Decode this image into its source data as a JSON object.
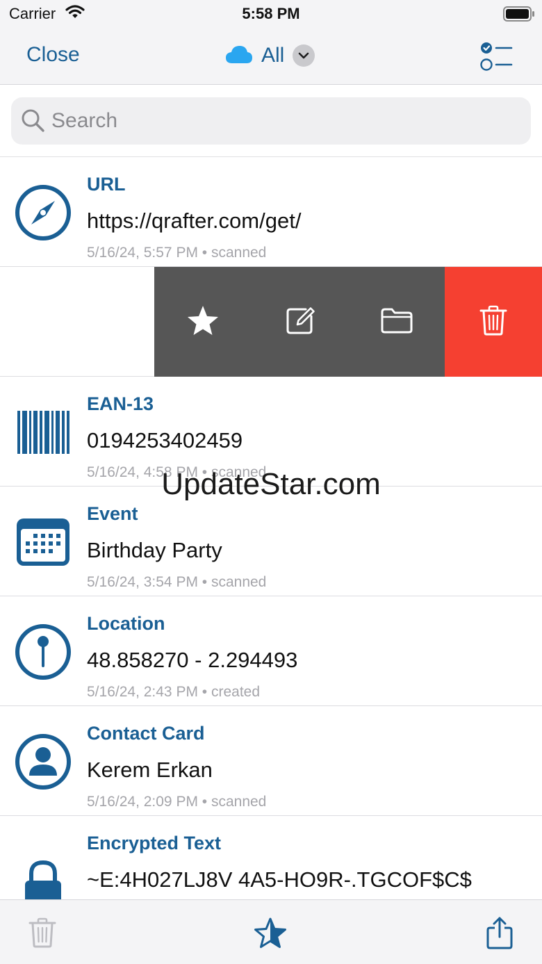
{
  "status_bar": {
    "carrier": "Carrier",
    "time": "5:58 PM"
  },
  "nav": {
    "close_label": "Close",
    "title": "All"
  },
  "search": {
    "placeholder": "Search"
  },
  "items": [
    {
      "type": "URL",
      "value": "https://qrafter.com/get/",
      "meta": "5/16/24, 5:57 PM • scanned",
      "icon": "compass-icon"
    },
    {
      "type": "EAN-13",
      "value": "0194253402459",
      "meta": "5/16/24, 4:58 PM • scanned",
      "icon": "barcode-icon"
    },
    {
      "type": "Event",
      "value": "Birthday Party",
      "meta": "5/16/24, 3:54 PM • scanned",
      "icon": "calendar-icon"
    },
    {
      "type": "Location",
      "value": "48.858270 - 2.294493",
      "meta": "5/16/24, 2:43 PM • created",
      "icon": "map-pin-icon"
    },
    {
      "type": "Contact Card",
      "value": "Kerem Erkan",
      "meta": "5/16/24, 2:09 PM • scanned",
      "icon": "person-icon"
    },
    {
      "type": "Encrypted Text",
      "value": "~E:4H027LJ8V 4A5-HO9R-.TGCOF$C$",
      "meta": "",
      "icon": "lock-icon"
    }
  ],
  "swipe_actions": [
    "star-icon",
    "edit-icon",
    "folder-icon",
    "trash-icon"
  ],
  "watermark": "UpdateStar.com",
  "colors": {
    "accent": "#1a5f94",
    "cloud": "#2aa6f0",
    "delete": "#f54031",
    "action_gray": "#565656"
  }
}
